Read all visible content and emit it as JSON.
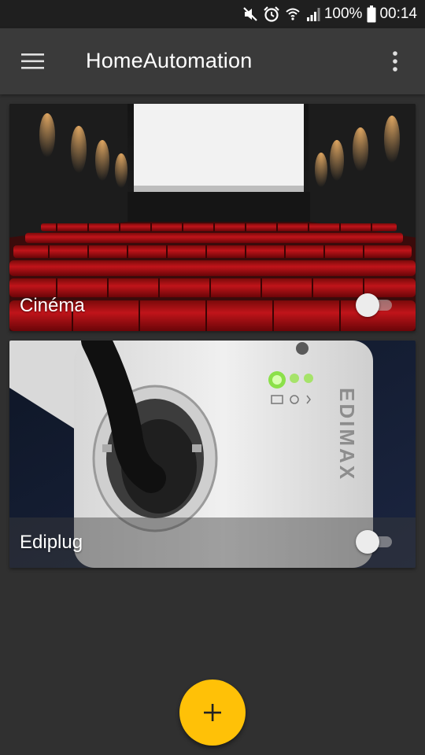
{
  "status_bar": {
    "battery": "100%",
    "time": "00:14",
    "icons": [
      "mute-icon",
      "alarm-icon",
      "wifi-icon",
      "signal-icon",
      "battery-icon"
    ]
  },
  "app_bar": {
    "title": "HomeAutomation",
    "background": "#3a3a3a",
    "icons": [
      "hamburger-menu-icon",
      "overflow-menu-icon"
    ]
  },
  "devices": [
    {
      "label": "Cinéma",
      "image": "cinema-auditorium-image",
      "switch_on": false
    },
    {
      "label": "Ediplug",
      "image": "smart-plug-image",
      "switch_on": false
    }
  ],
  "fab": {
    "icon": "add-icon",
    "color": "#ffc107"
  },
  "colors": {
    "background": "#303030",
    "status_bar": "#1f1f1f"
  }
}
